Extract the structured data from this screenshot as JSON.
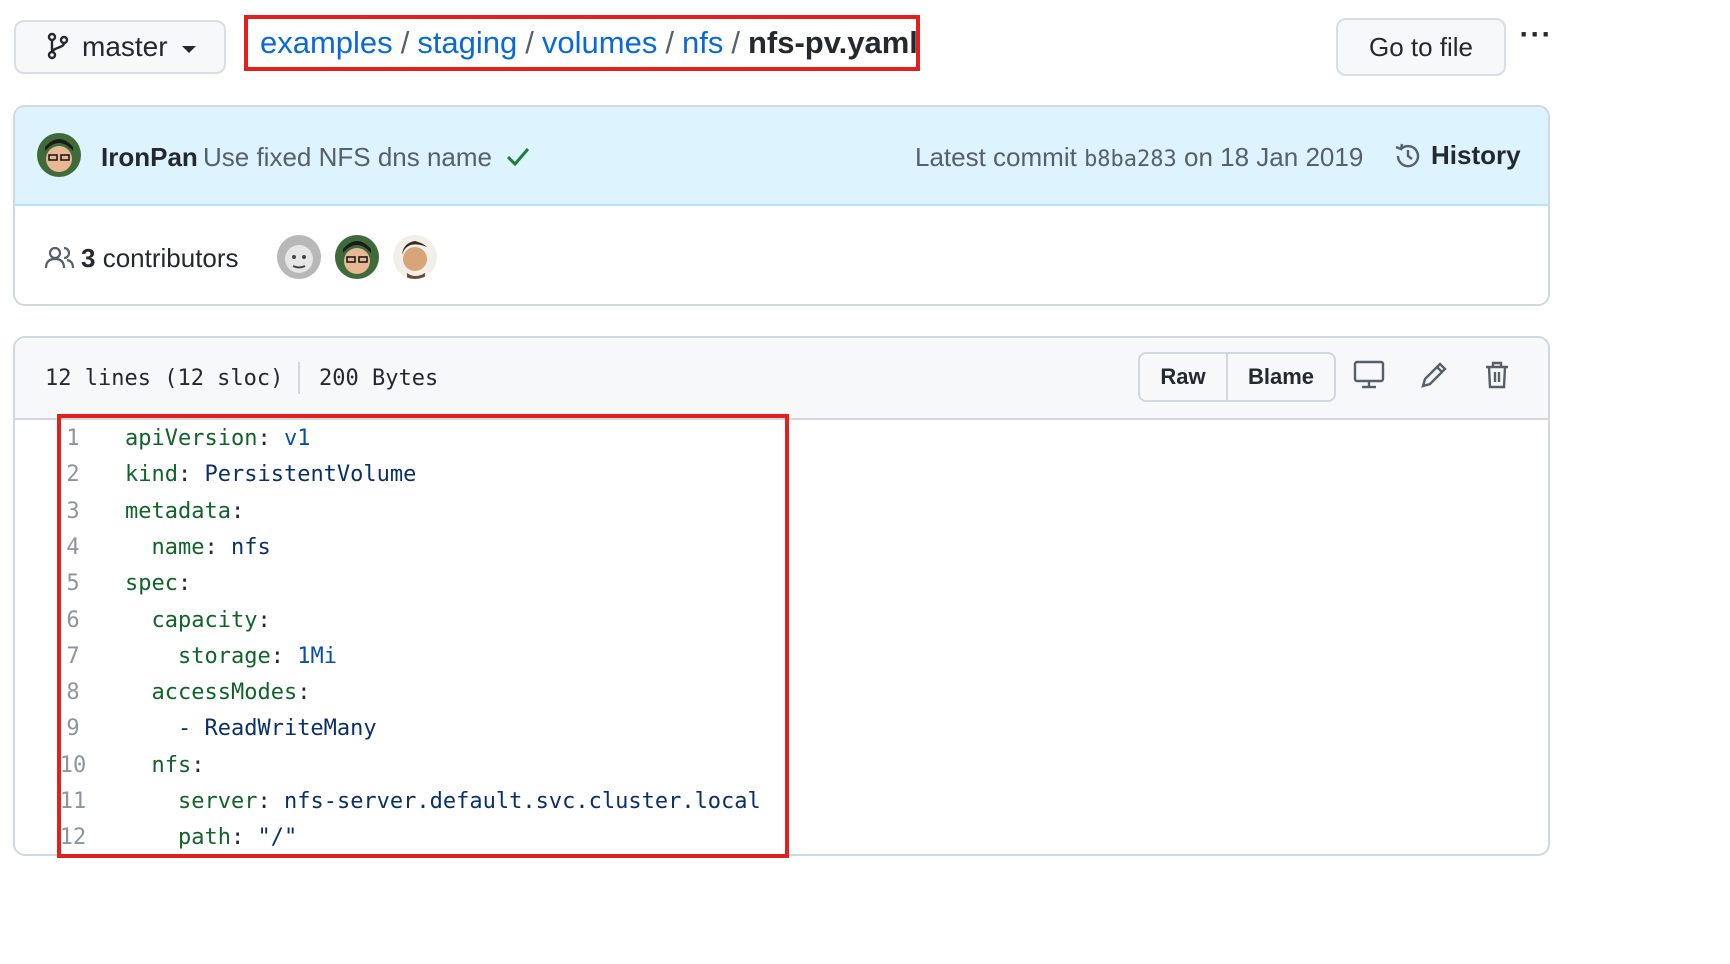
{
  "branch": {
    "label": "master"
  },
  "breadcrumb": {
    "segments": [
      "examples",
      "staging",
      "volumes",
      "nfs"
    ],
    "separator": "/",
    "current": "nfs-pv.yaml"
  },
  "toolbar": {
    "go_to_file": "Go to file",
    "more": "···"
  },
  "commit": {
    "author": "IronPan",
    "message": "Use fixed NFS dns name",
    "latest_prefix": "Latest commit",
    "sha": "b8ba283",
    "date_text": "on 18 Jan 2019",
    "history_label": "History"
  },
  "contributors": {
    "count": "3",
    "label": "contributors"
  },
  "file": {
    "lines_info": "12 lines (12 sloc)",
    "size": "200 Bytes",
    "raw_label": "Raw",
    "blame_label": "Blame"
  },
  "code": [
    {
      "n": "1",
      "indent": "",
      "key": "apiVersion",
      "colon": ":",
      "value": " v1"
    },
    {
      "n": "2",
      "indent": "",
      "key": "kind",
      "colon": ":",
      "value": " PersistentVolume"
    },
    {
      "n": "3",
      "indent": "",
      "key": "metadata",
      "colon": ":",
      "value": ""
    },
    {
      "n": "4",
      "indent": "  ",
      "key": "name",
      "colon": ":",
      "value": " nfs"
    },
    {
      "n": "5",
      "indent": "",
      "key": "spec",
      "colon": ":",
      "value": ""
    },
    {
      "n": "6",
      "indent": "  ",
      "key": "capacity",
      "colon": ":",
      "value": ""
    },
    {
      "n": "7",
      "indent": "    ",
      "key": "storage",
      "colon": ":",
      "value": " 1Mi"
    },
    {
      "n": "8",
      "indent": "  ",
      "key": "accessModes",
      "colon": ":",
      "value": ""
    },
    {
      "n": "9",
      "indent": "    ",
      "key": "",
      "colon": "",
      "value": "- ReadWriteMany"
    },
    {
      "n": "10",
      "indent": "  ",
      "key": "nfs",
      "colon": ":",
      "value": ""
    },
    {
      "n": "11",
      "indent": "    ",
      "key": "server",
      "colon": ":",
      "value": " nfs-server.default.svc.cluster.local"
    },
    {
      "n": "12",
      "indent": "    ",
      "key": "path",
      "colon": ":",
      "value": " \"/\""
    }
  ],
  "colors": {
    "link": "#0969da",
    "highlight_border": "#e3201b",
    "commit_bar": "#ddf4ff",
    "yaml_key": "#116329"
  },
  "icons": [
    "git-branch-icon",
    "check-icon",
    "history-icon",
    "people-icon",
    "display-icon",
    "pencil-icon",
    "trash-icon"
  ]
}
